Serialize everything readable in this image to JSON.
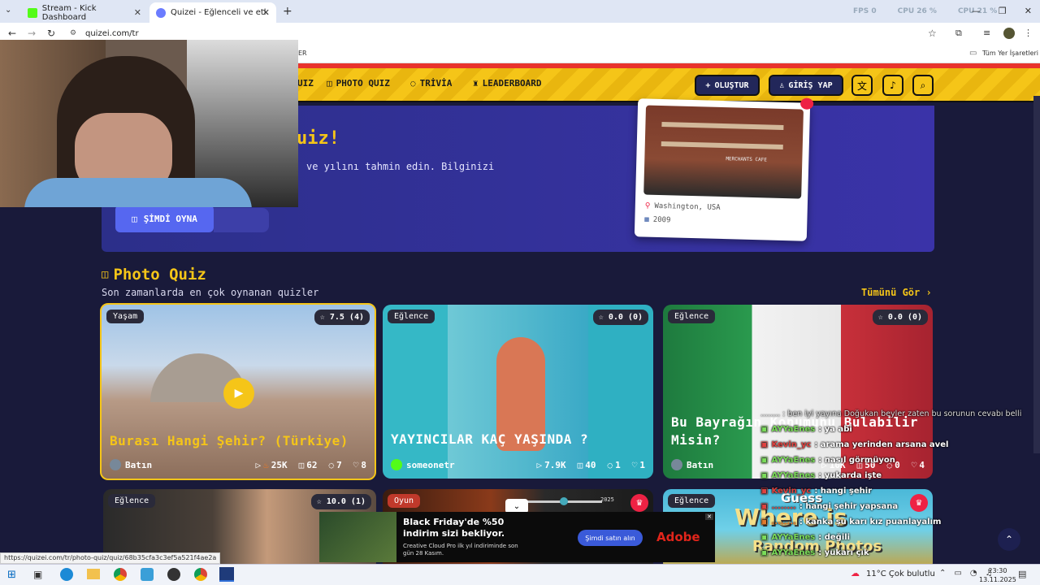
{
  "browser": {
    "tabs": [
      {
        "title": "Stream - Kick Dashboard"
      },
      {
        "title": "Quizei - Eğlenceli ve etkileşiml"
      }
    ],
    "url": "quizei.com/tr",
    "bookmark_folder": "Tüm Yer İşaretleri",
    "bookmark_partial": "ER",
    "status_url": "https://quizei.com/tr/photo-quiz/quiz/68b35cfa3c3ef5a521f4ae2a",
    "overlay_stats": [
      "FPS  0",
      "CPU 26 %",
      "CPU 21 %"
    ]
  },
  "nav": {
    "quiz_partial": "UIZ",
    "photo_quiz": "PHOTO QUIZ",
    "trivia": "TRİVİA",
    "leaderboard": "LEADERBOARD",
    "create": "OLUŞTUR",
    "login": "GİRİŞ YAP"
  },
  "hero": {
    "title_partial": "uiz!",
    "desc_partial": "ve yılını tahmin edin. Bilginizi",
    "play_button": "ŞİMDİ OYNA",
    "sample_location": "Washington, USA",
    "sample_year": "2009",
    "sample_sign": "MERCHANTS CAFE"
  },
  "section": {
    "title": "Photo Quiz",
    "subtitle": "Son zamanlarda en çok oynanan quizler",
    "see_all": "Tümünü Gör"
  },
  "cards": [
    {
      "category": "Yaşam",
      "rating": "7.5 (4)",
      "title": "Burası Hangi Şehir? (Türkiye)",
      "author": "Batın",
      "plays": "25K",
      "photos": "62",
      "comments": "7",
      "likes": "8"
    },
    {
      "category": "Eğlence",
      "rating": "0.0 (0)",
      "title": "YAYINCILAR KAÇ YAŞINDA ?",
      "author": "someonetr",
      "plays": "7.9K",
      "photos": "40",
      "comments": "1",
      "likes": "1"
    },
    {
      "category": "Eğlence",
      "rating": "0.0 (0)",
      "title": "Bu Bayrağın Konumunu Bulabilir Misin?",
      "author": "Batın",
      "plays": "10K",
      "photos": "50",
      "comments": "0",
      "likes": "4"
    }
  ],
  "cards_row2": [
    {
      "category": "Eğlence",
      "rating": "10.0 (1)"
    },
    {
      "category": "Oyun",
      "slider_value": "2025"
    },
    {
      "category": "Eğlence",
      "title_partial_1": "Where is",
      "title_partial_2": "Guess",
      "title_partial_3": "Random Photos"
    }
  ],
  "ad": {
    "headline": "Black Friday'de %50 indirim sizi bekliyor.",
    "body": "Creative Cloud Pro ilk yıl indiriminde son gün 28 Kasım.",
    "cta": "Şimdi satın alın",
    "brand": "Adobe"
  },
  "chat": {
    "top_line": "........ : ben iyi yayına Doğukan beyler zaten bu sorunun cevabı belli",
    "messages": [
      {
        "user": "AYYaEnes",
        "text": "ya abi",
        "color": "#7bdc5a"
      },
      {
        "user": "Kevin_yc",
        "text": "arama yerinden arsana avel",
        "color": "#e0423f"
      },
      {
        "user": "AYYaEnes",
        "text": "nasıl görmüyon",
        "color": "#7bdc5a"
      },
      {
        "user": "AYYaEnes",
        "text": "yukarda işte",
        "color": "#7bdc5a"
      },
      {
        "user": "Kevin_yc",
        "text": "hangi şehir",
        "color": "#e0423f"
      },
      {
        "user": "........",
        "text": "hangi şehir yapsana",
        "color": "#e0423f"
      },
      {
        "user": "........",
        "text": "kanka şu karı kız puanlayalım",
        "color": "#e07a2f"
      },
      {
        "user": "AYYaEnes",
        "text": "değili",
        "color": "#7bdc5a"
      },
      {
        "user": "AYYaEnes",
        "text": "yukarı çık",
        "color": "#7bdc5a"
      }
    ]
  },
  "taskbar": {
    "weather": "11°C  Çok bulutlu",
    "time": "23:30",
    "date": "13.11.2025"
  },
  "colors": {
    "accent_yellow": "#f5c518",
    "dark_bg": "#191a3a",
    "hero_bg": "#3a33a8"
  }
}
